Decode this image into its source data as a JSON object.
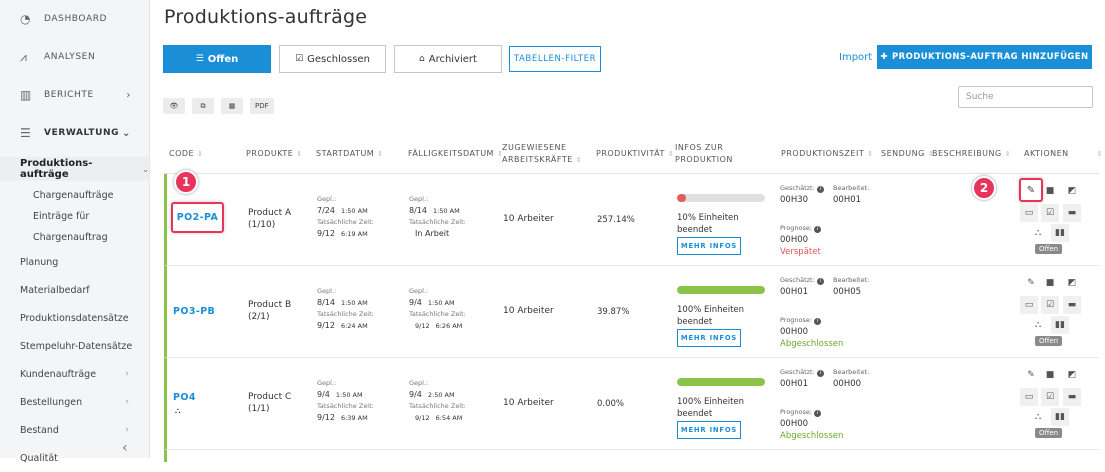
{
  "sidebar": {
    "top": [
      {
        "label": "DASHBOARD",
        "icon": "gauge-icon"
      },
      {
        "label": "ANALYSEN",
        "icon": "chart-icon"
      },
      {
        "label": "BERICHTE",
        "icon": "report-icon"
      },
      {
        "label": "VERWALTUNG",
        "icon": "sliders-icon"
      }
    ],
    "active": "Produktions-aufträge",
    "sub": [
      "Chargenaufträge",
      "Einträge für",
      "Chargenauftrag"
    ],
    "items": [
      "Planung",
      "Materialbedarf",
      "Produktionsdatensätze",
      "Stempeluhr-Datensätze",
      "Kundenaufträge",
      "Bestellungen",
      "Bestand",
      "Qualität"
    ]
  },
  "page": {
    "title": "Produktions-aufträge",
    "tabs": {
      "open": "Offen",
      "closed": "Geschlossen",
      "archived": "Archiviert",
      "filter": "TABELLEN-FILTER"
    },
    "import": "Import",
    "add": "PRODUKTIONS-AUFTRAG HINZUFÜGEN",
    "pdf": "PDF",
    "search_placeholder": "Suche"
  },
  "table": {
    "headers": {
      "code": "CODE",
      "products": "PRODUKTE",
      "start": "STARTDATUM",
      "due": "FÄLLIGKEITSDATUM",
      "workers1": "ZUGEWIESENE",
      "workers2": "ARBEITSKRÄFTE",
      "productivity": "PRODUKTIVITÄT",
      "info1": "INFOS ZUR",
      "info2": "PRODUKTION",
      "prodtime": "PRODUKTIONSZEIT",
      "shipment": "SENDUNG",
      "desc": "BESCHREIBUNG",
      "actions": "AKTIONEN"
    },
    "labels": {
      "planned": "Gepl.:",
      "actual": "Tatsächliche Zeit:",
      "more": "MEHR INFOS",
      "estimated": "Geschätzt:",
      "processed": "Bearbeitet:",
      "forecast": "Prognose:",
      "open_badge": "Offen"
    },
    "rows": [
      {
        "code": "PO2-PA",
        "product": "Product A",
        "qty": "(1/10)",
        "start_date": "7/24",
        "start_time": "1:50 AM",
        "start_actual_date": "9/12",
        "start_actual_time": "6:19 AM",
        "due_date": "8/14",
        "due_time": "1:50 AM",
        "due_actual": "In Arbeit",
        "due_actual_time": "",
        "workers": "10 Arbeiter",
        "productivity": "257.14%",
        "progress": 0.1,
        "progress_text": "10% Einheiten",
        "progress_text2": "beendet",
        "progress_color": "#e35b5b",
        "est": "00H30",
        "proc": "00H01",
        "forecast": "00H00",
        "status": "Verspätet",
        "status_type": "red"
      },
      {
        "code": "PO3-PB",
        "product": "Product B",
        "qty": "(2/1)",
        "start_date": "8/14",
        "start_time": "1:50 AM",
        "start_actual_date": "9/12",
        "start_actual_time": "6:24 AM",
        "due_date": "9/4",
        "due_time": "1:50 AM",
        "due_actual": "9/12",
        "due_actual_time": "6:26 AM",
        "workers": "10 Arbeiter",
        "productivity": "39.87%",
        "progress": 1.0,
        "progress_text": "100% Einheiten",
        "progress_text2": "beendet",
        "progress_color": "#8bc34a",
        "est": "00H01",
        "proc": "00H05",
        "forecast": "00H00",
        "status": "Abgeschlossen",
        "status_type": "green"
      },
      {
        "code": "PO4",
        "product": "Product C",
        "qty": "(1/1)",
        "start_date": "9/4",
        "start_time": "1:50 AM",
        "start_actual_date": "9/12",
        "start_actual_time": "6:39 AM",
        "due_date": "9/4",
        "due_time": "2:50 AM",
        "due_actual": "9/12",
        "due_actual_time": "6:54 AM",
        "workers": "10 Arbeiter",
        "productivity": "0.00%",
        "progress": 1.0,
        "progress_text": "100% Einheiten",
        "progress_text2": "beendet",
        "progress_color": "#8bc34a",
        "est": "00H01",
        "proc": "00H00",
        "forecast": "00H00",
        "status": "Abgeschlossen",
        "status_type": "green"
      }
    ]
  },
  "markers": [
    "1",
    "2"
  ],
  "colors": {
    "accent": "#1a8fd8",
    "highlight": "#e8345a",
    "done": "#8bc34a"
  }
}
